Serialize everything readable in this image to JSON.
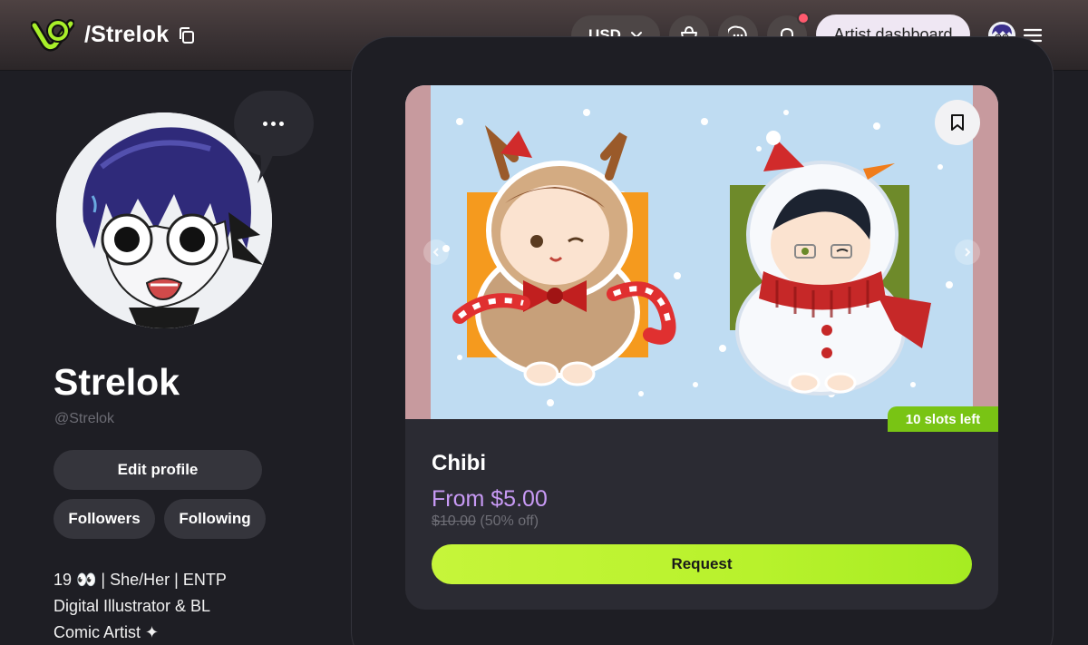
{
  "header": {
    "handle": "/Strelok",
    "currency": "USD",
    "artist_dashboard": "Artist dashboard"
  },
  "profile": {
    "name": "Strelok",
    "handle": "@Strelok",
    "edit_profile": "Edit profile",
    "followers": "Followers",
    "following": "Following",
    "bio_lines": [
      "19 👀 | She/Her | ENTP",
      "Digital Illustrator & BL",
      "Comic Artist ✦"
    ]
  },
  "listing": {
    "slots_left": "10 slots left",
    "title": "Chibi",
    "price": "From $5.00",
    "original_price": "$10.00",
    "discount": "(50% off)",
    "request": "Request"
  },
  "colors": {
    "accent_green": "#b8f22c",
    "price_purple": "#c89af5",
    "badge_green": "#79c414",
    "notification_dot": "#ff5a6e"
  },
  "icons": [
    "logo-icon",
    "copy-icon",
    "chevron-down-icon",
    "cart-icon",
    "chat-icon",
    "bell-icon",
    "menu-icon",
    "more-icon",
    "bookmark-icon",
    "chevron-left-icon",
    "chevron-right-icon"
  ]
}
